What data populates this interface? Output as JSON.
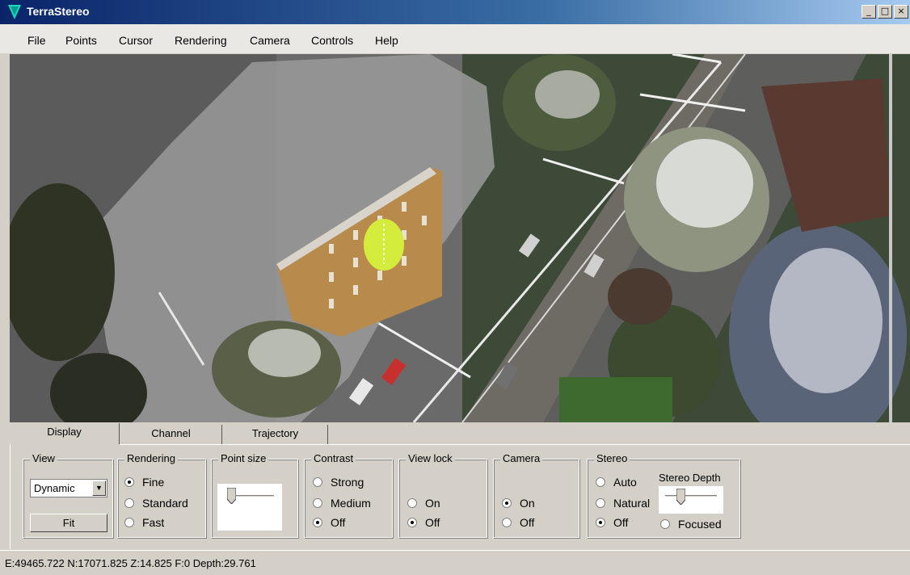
{
  "window": {
    "title": "TerraStereo",
    "minimize": "_",
    "maximize": "□",
    "close": "×"
  },
  "menu": {
    "items": [
      "File",
      "Points",
      "Cursor",
      "Rendering",
      "Camera",
      "Controls",
      "Help"
    ]
  },
  "tabs": {
    "items": [
      "Display",
      "Channel",
      "Trajectory"
    ],
    "active": "Display"
  },
  "groups": {
    "view": {
      "label": "View",
      "select_value": "Dynamic",
      "fit_label": "Fit"
    },
    "rendering": {
      "label": "Rendering",
      "options": [
        "Fine",
        "Standard",
        "Fast"
      ],
      "selected": "Fine"
    },
    "point_size": {
      "label": "Point size"
    },
    "contrast": {
      "label": "Contrast",
      "options": [
        "Strong",
        "Medium",
        "Off"
      ],
      "selected": "Off"
    },
    "view_lock": {
      "label": "View lock",
      "options": [
        "On",
        "Off"
      ],
      "selected": "Off"
    },
    "camera": {
      "label": "Camera",
      "options": [
        "On",
        "Off"
      ],
      "selected": "On"
    },
    "stereo": {
      "label": "Stereo",
      "options": [
        "Auto",
        "Natural",
        "Off"
      ],
      "selected": "Off",
      "depth_label": "Stereo Depth",
      "focused_label": "Focused"
    }
  },
  "status": {
    "text": "E:49465.722 N:17071.825 Z:14.825 F:0 Depth:29.761"
  },
  "colors": {
    "title_start": "#0a246a",
    "title_end": "#a6caf0",
    "panel": "#d4d0c8",
    "cursor_highlight": "#d4ec3c"
  }
}
